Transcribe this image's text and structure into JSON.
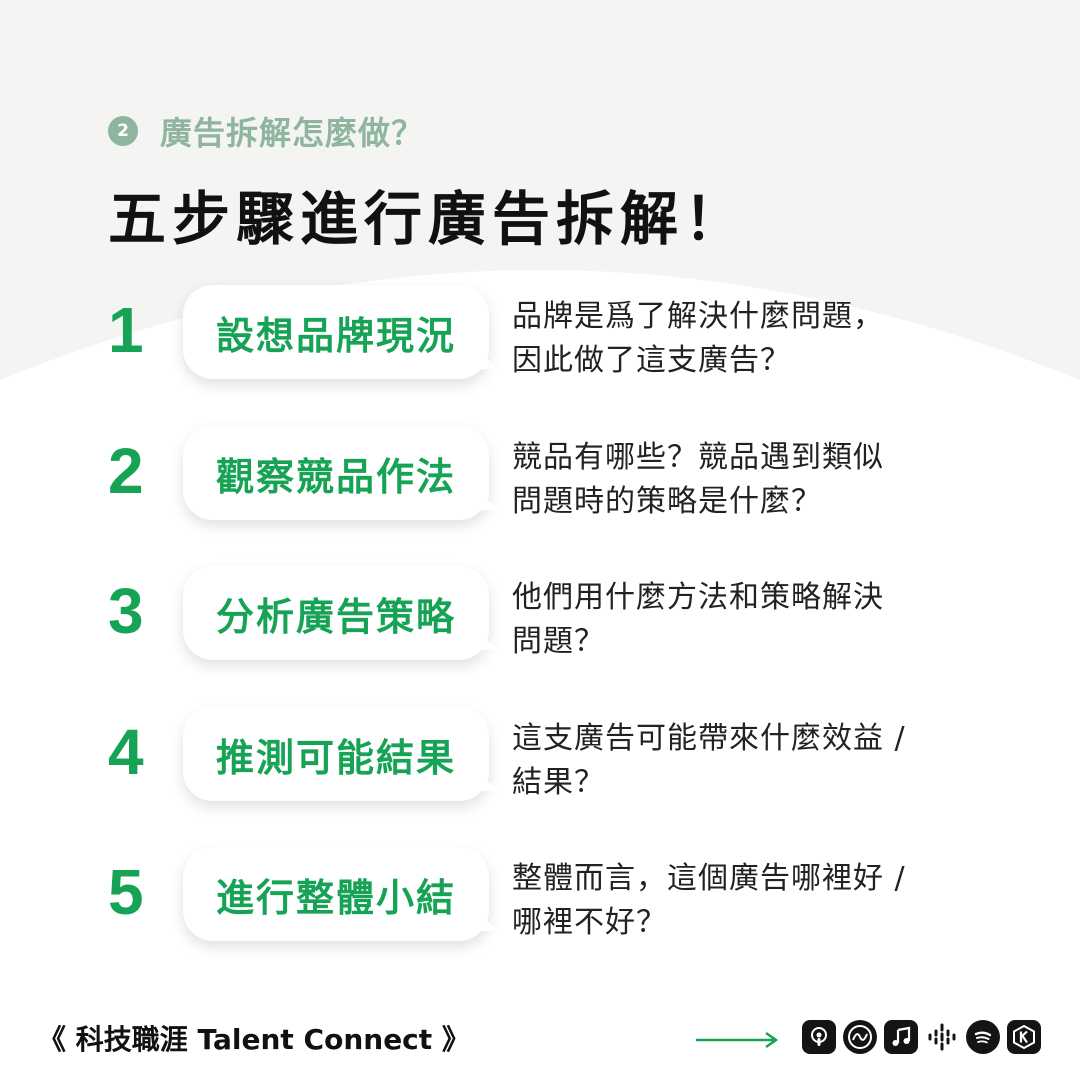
{
  "header": {
    "step_badge": "2",
    "subtitle": "廣告拆解怎麼做？",
    "title": "五步驟進行廣告拆解！"
  },
  "steps": [
    {
      "number": "1",
      "label": "設想品牌現況",
      "desc": [
        "品牌是爲了解決什麼問題，",
        "因此做了這支廣告？"
      ]
    },
    {
      "number": "2",
      "label": "觀察競品作法",
      "desc": [
        "競品有哪些？競品遇到類似",
        "問題時的策略是什麼？"
      ]
    },
    {
      "number": "3",
      "label": "分析廣告策略",
      "desc": [
        "他們用什麼方法和策略解決",
        "問題？"
      ]
    },
    {
      "number": "4",
      "label": "推測可能結果",
      "desc": [
        "這支廣告可能帶來什麼效益 /",
        "結果？"
      ]
    },
    {
      "number": "5",
      "label": "進行整體小結",
      "desc": [
        "整體而言，這個廣告哪裡好 /",
        "哪裡不好？"
      ]
    }
  ],
  "footer": {
    "brand": "《 科技職涯 Talent Connect 》",
    "platform_icons": [
      "apple-podcasts-icon",
      "soundon-icon",
      "music-note-icon",
      "google-podcasts-icon",
      "spotify-icon",
      "kkbox-icon"
    ]
  },
  "colors": {
    "accent_green": "#17a356",
    "muted_green": "#8fb59e",
    "background_gray": "#f4f4f3"
  }
}
